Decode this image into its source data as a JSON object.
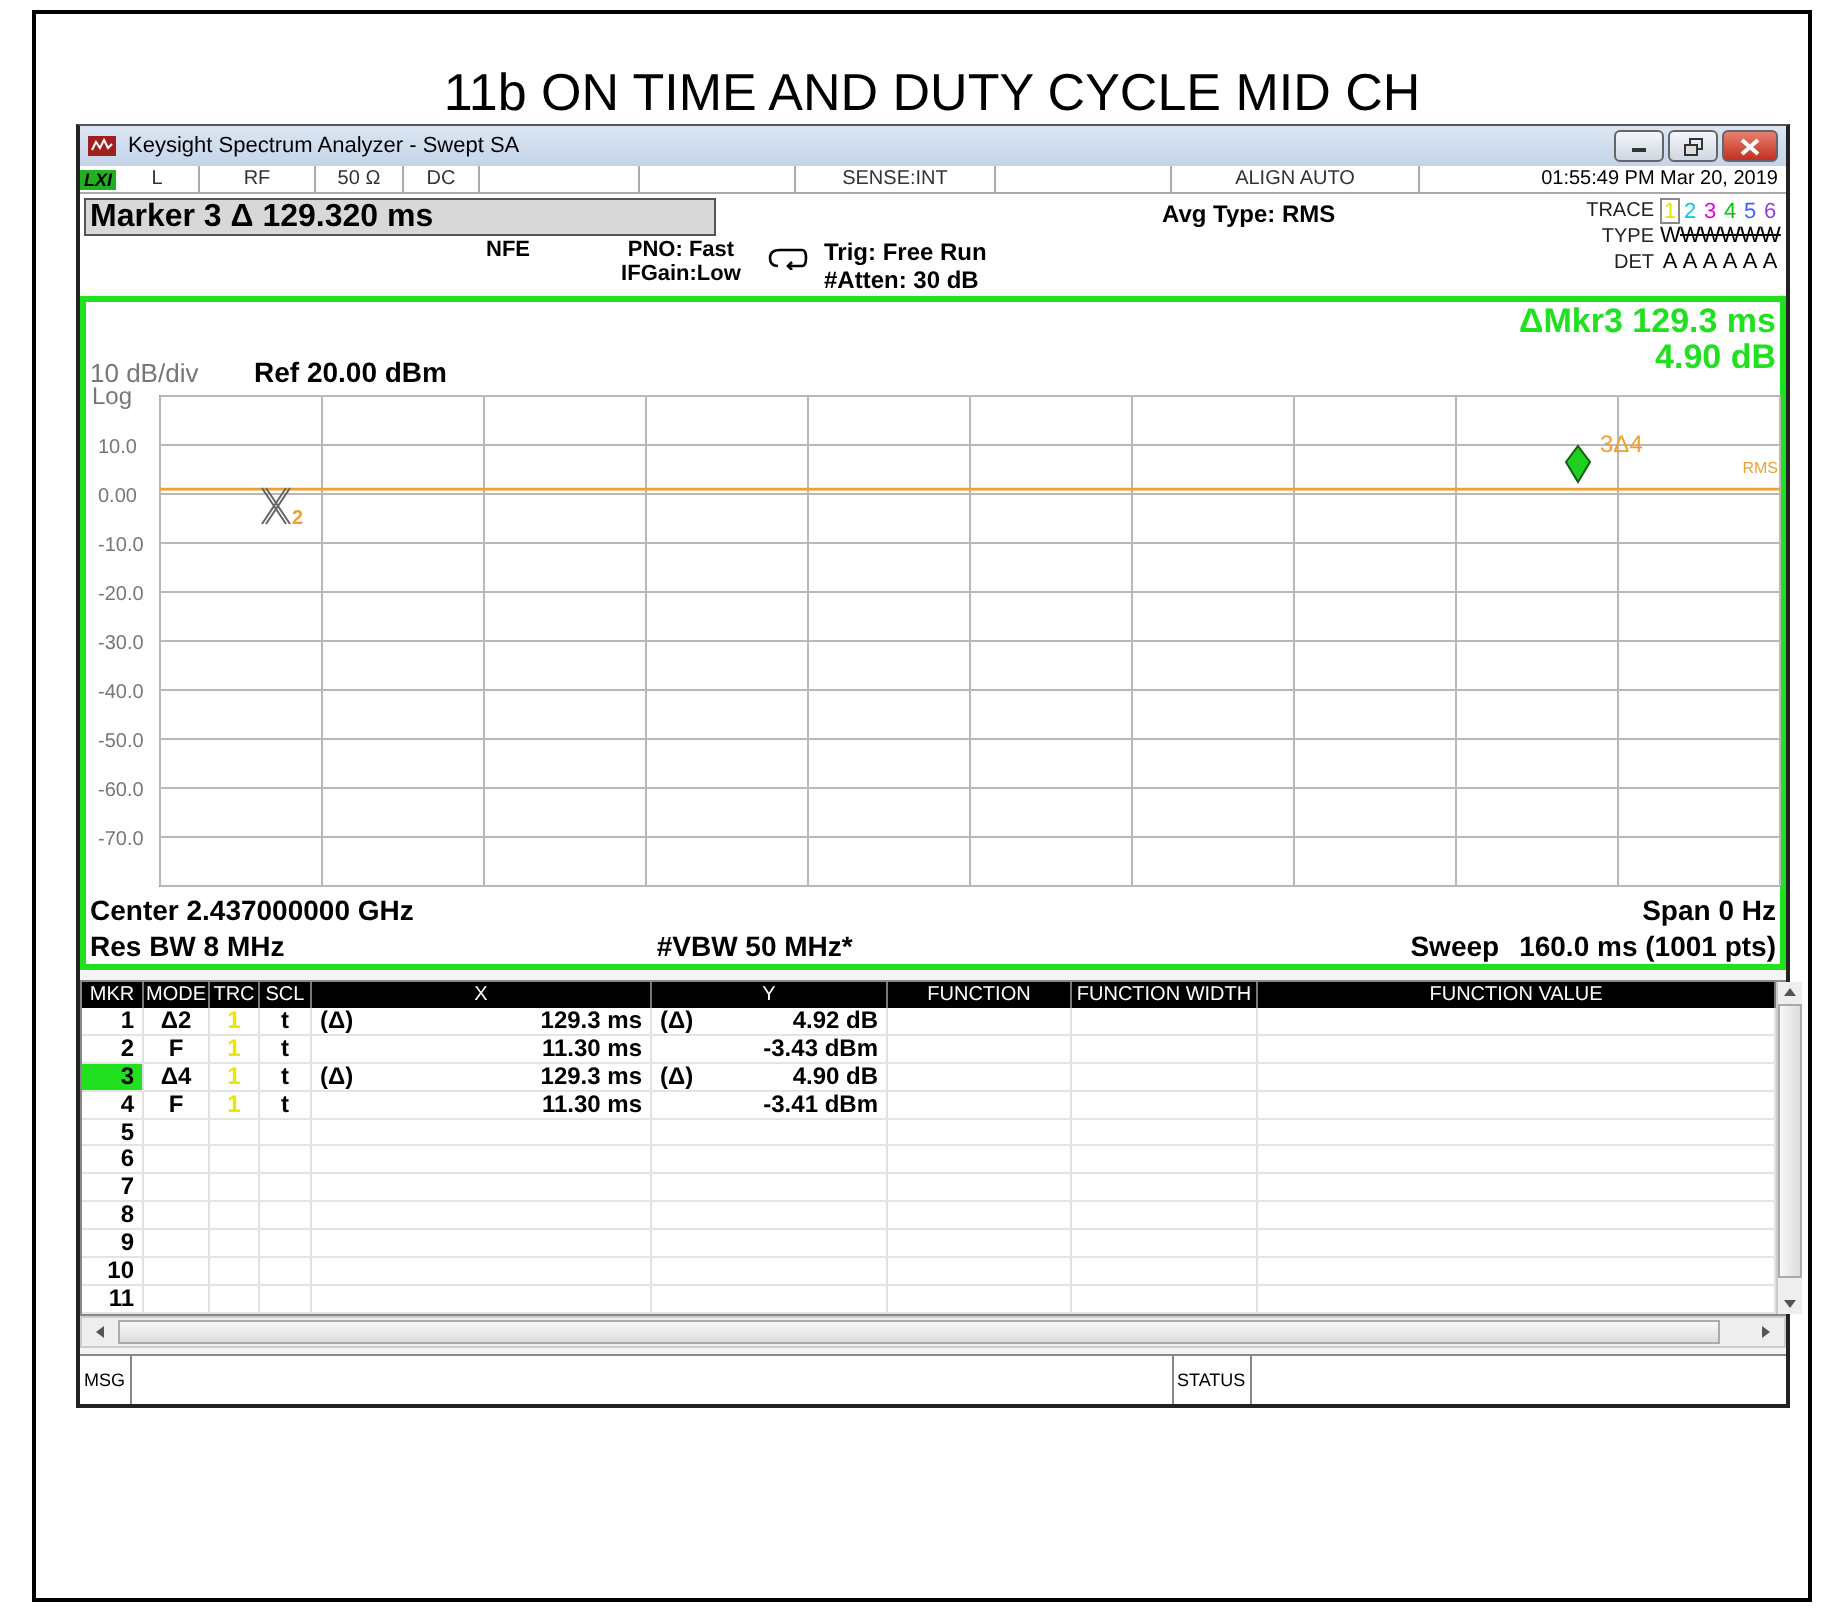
{
  "document_title": "11b ON TIME AND DUTY CYCLE MID CH",
  "window": {
    "title": "Keysight Spectrum Analyzer - Swept SA"
  },
  "status_strip": {
    "logo": "LXI",
    "cells": [
      "L",
      "RF",
      "50 Ω",
      "DC",
      "",
      "",
      "SENSE:INT",
      "",
      "ALIGN AUTO"
    ],
    "datetime": "01:55:49 PM Mar 20, 2019"
  },
  "marker_readout": "Marker 3 Δ 129.320 ms",
  "settings": {
    "nfe": "NFE",
    "pno": "PNO: Fast",
    "ifgain": "IFGain:Low",
    "trig": "Trig: Free Run",
    "atten": "#Atten: 30 dB",
    "avg": "Avg Type: RMS"
  },
  "trace_panel": {
    "labels": [
      "TRACE",
      "TYPE",
      "DET"
    ],
    "traces": [
      {
        "number": "1",
        "color": "#e8e800",
        "type": "W",
        "det": "A",
        "selected": true,
        "blanked": false
      },
      {
        "number": "2",
        "color": "#00c8e8",
        "type": "W",
        "det": "A",
        "selected": false,
        "blanked": true
      },
      {
        "number": "3",
        "color": "#e000e0",
        "type": "W",
        "det": "A",
        "selected": false,
        "blanked": true
      },
      {
        "number": "4",
        "color": "#00c800",
        "type": "W",
        "det": "A",
        "selected": false,
        "blanked": true
      },
      {
        "number": "5",
        "color": "#4060ff",
        "type": "W",
        "det": "A",
        "selected": false,
        "blanked": true
      },
      {
        "number": "6",
        "color": "#9040e0",
        "type": "W",
        "det": "A",
        "selected": false,
        "blanked": true
      }
    ]
  },
  "plot": {
    "delta_marker": "ΔMkr3 129.3 ms",
    "delta_value": "4.90 dB",
    "scale": "10 dB/div",
    "ref": "Ref 20.00 dBm",
    "scale_type": "Log",
    "y_labels": [
      "10.0",
      "0.00",
      "-10.0",
      "-20.0",
      "-30.0",
      "-40.0",
      "-50.0",
      "-60.0",
      "-70.0"
    ],
    "marker_label": "3Δ4",
    "marker_2_label": "2",
    "trace_label": "RMS",
    "center": "Center 2.437000000 GHz",
    "span": "Span 0 Hz",
    "res_bw": "Res BW 8 MHz",
    "vbw": "#VBW 50 MHz*",
    "sweep_label": "Sweep",
    "sweep": "160.0 ms (1001 pts)"
  },
  "marker_table": {
    "columns": [
      "MKR",
      "MODE",
      "TRC",
      "SCL",
      "X",
      "Y",
      "FUNCTION",
      "FUNCTION WIDTH",
      "FUNCTION VALUE"
    ],
    "rows": [
      {
        "mkr": "1",
        "mode": "Δ2",
        "trc": "1",
        "scl": "t",
        "x_ref": "(Δ)",
        "x": "129.3 ms",
        "y_ref": "(Δ)",
        "y": "4.92 dB",
        "selected": false
      },
      {
        "mkr": "2",
        "mode": "F",
        "trc": "1",
        "scl": "t",
        "x": "11.30 ms",
        "y": "-3.43 dBm",
        "selected": false
      },
      {
        "mkr": "3",
        "mode": "Δ4",
        "trc": "1",
        "scl": "t",
        "x_ref": "(Δ)",
        "x": "129.3 ms",
        "y_ref": "(Δ)",
        "y": "4.90 dB",
        "selected": true
      },
      {
        "mkr": "4",
        "mode": "F",
        "trc": "1",
        "scl": "t",
        "x": "11.30 ms",
        "y": "-3.41 dBm",
        "selected": false
      },
      {
        "mkr": "5",
        "selected": false
      },
      {
        "mkr": "6",
        "selected": false
      },
      {
        "mkr": "7",
        "selected": false
      },
      {
        "mkr": "8",
        "selected": false
      },
      {
        "mkr": "9",
        "selected": false
      },
      {
        "mkr": "10",
        "selected": false
      },
      {
        "mkr": "11",
        "selected": false
      }
    ]
  },
  "msg_bar": {
    "msg": "MSG",
    "status": "STATUS"
  }
}
